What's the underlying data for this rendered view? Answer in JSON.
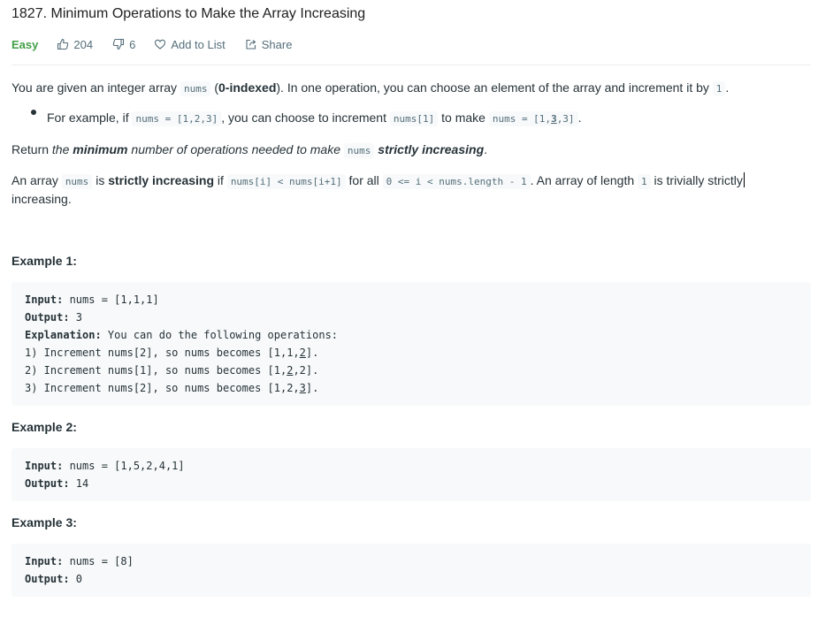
{
  "problem": {
    "title": "1827. Minimum Operations to Make the Array Increasing",
    "difficulty": "Easy",
    "likes": "204",
    "dislikes": "6",
    "add_to_list": "Add to List",
    "share": "Share",
    "colors": {
      "easy": "#43a047",
      "text": "#263238",
      "muted": "#546e7a",
      "code_bg": "#f7f9fa"
    }
  },
  "description": {
    "p1": [
      "You are given an integer array ",
      "nums",
      " (",
      "0-indexed",
      "). In one operation, you can choose an element of the array and increment it by ",
      "1",
      "."
    ],
    "bullet": [
      "For example, if ",
      "nums = [1,2,3]",
      ", you can choose to increment ",
      "nums[1]",
      " to make ",
      "nums = [1,",
      "3",
      ",3]",
      "."
    ],
    "p2": [
      "Return ",
      "the ",
      "minimum",
      " number of operations needed to make ",
      "nums",
      " ",
      "strictly increasing",
      "."
    ],
    "p3": [
      "An array ",
      "nums",
      " is ",
      "strictly increasing",
      " if ",
      "nums[i] < nums[i+1]",
      " for all ",
      "0 <= i < nums.length - 1",
      ". An array of length ",
      "1",
      " is trivially strictly"
    ],
    "p3_cont": "increasing."
  },
  "examples": [
    {
      "heading": "Example 1:",
      "input_label": "Input:",
      "input": " nums = [1,1,1]",
      "output_label": "Output:",
      "output": " 3",
      "explanation_label": "Explanation:",
      "explanation": " You can do the following operations:",
      "steps": [
        {
          "pre": "1) Increment nums[2], so nums becomes [1,1,",
          "u": "2",
          "post": "]."
        },
        {
          "pre": "2) Increment nums[1], so nums becomes [1,",
          "u": "2",
          "post": ",2]."
        },
        {
          "pre": "3) Increment nums[2], so nums becomes [1,2,",
          "u": "3",
          "post": "]."
        }
      ]
    },
    {
      "heading": "Example 2:",
      "input_label": "Input:",
      "input": " nums = [1,5,2,4,1]",
      "output_label": "Output:",
      "output": " 14"
    },
    {
      "heading": "Example 3:",
      "input_label": "Input:",
      "input": " nums = [8]",
      "output_label": "Output:",
      "output": " 0"
    }
  ]
}
